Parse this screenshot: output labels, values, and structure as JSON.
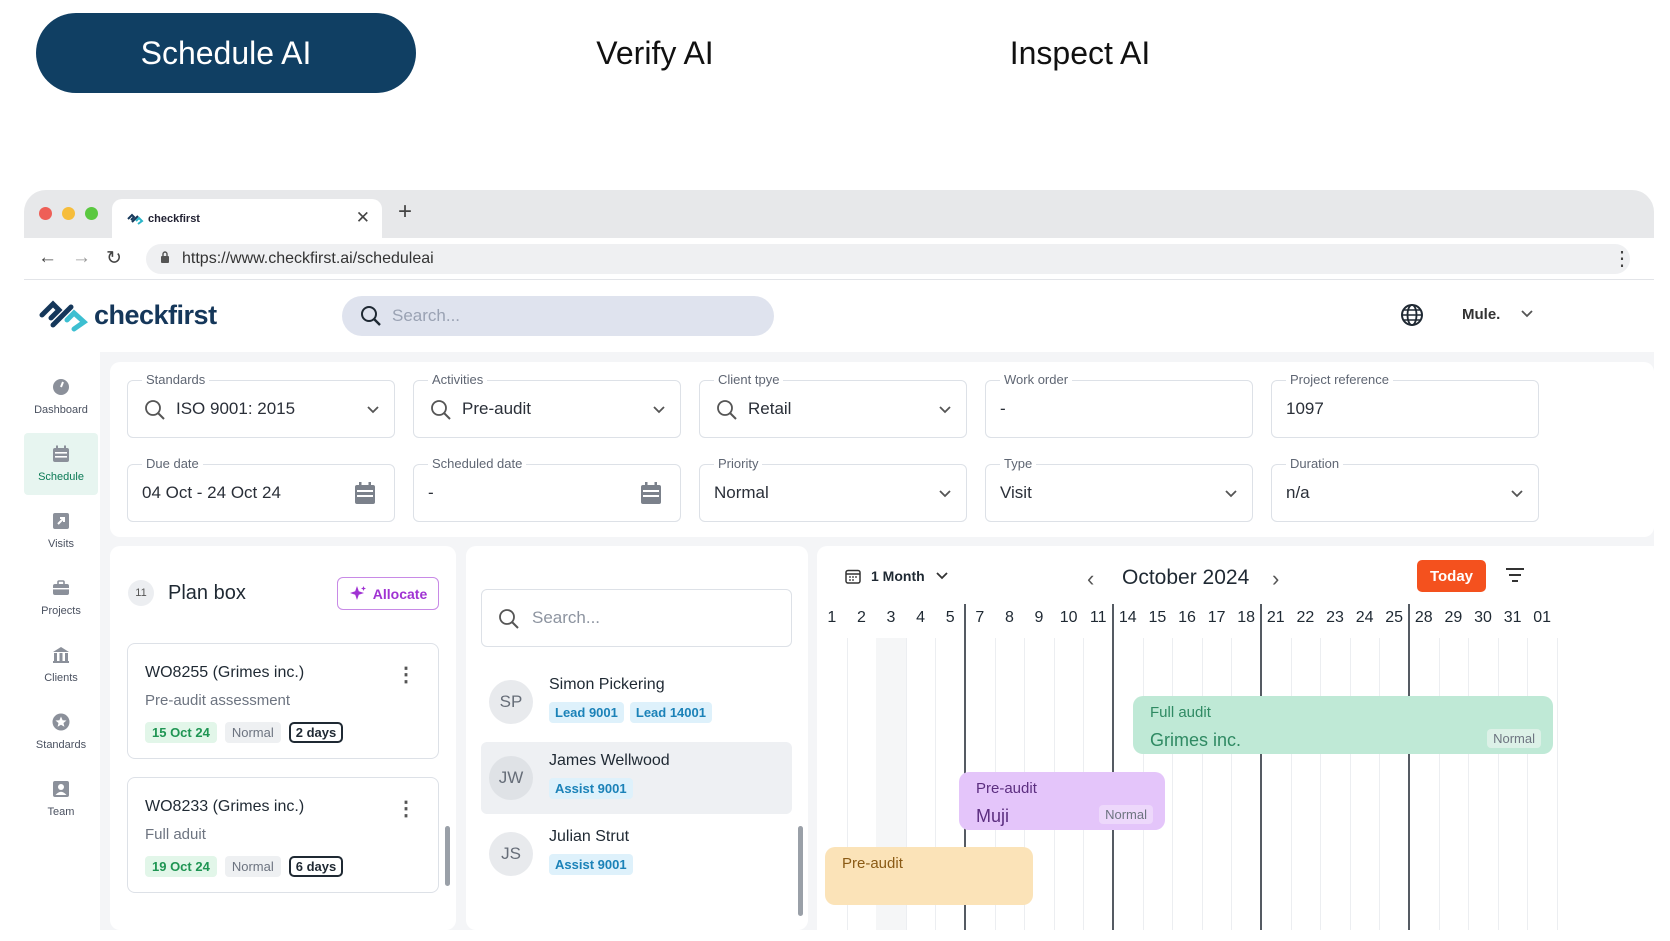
{
  "product_tabs": [
    "Schedule AI",
    "Verify AI",
    "Inspect AI"
  ],
  "browser": {
    "tab_title": "checkfirst",
    "url": "https://www.checkfirst.ai/scheduleai"
  },
  "app": {
    "logo": "checkfirst",
    "search_placeholder": "Search...",
    "user": "Mule."
  },
  "sidebar": [
    {
      "label": "Dashboard",
      "icon": "dashboard-icon"
    },
    {
      "label": "Schedule",
      "icon": "calendar-icon",
      "active": true
    },
    {
      "label": "Visits",
      "icon": "visits-icon"
    },
    {
      "label": "Projects",
      "icon": "briefcase-icon"
    },
    {
      "label": "Clients",
      "icon": "building-icon"
    },
    {
      "label": "Standards",
      "icon": "star-icon"
    },
    {
      "label": "Team",
      "icon": "person-icon"
    }
  ],
  "filters": [
    {
      "label": "Standards",
      "value": "ISO 9001: 2015"
    },
    {
      "label": "Activities",
      "value": "Pre-audit"
    },
    {
      "label": "Client tpye",
      "value": "Retail"
    },
    {
      "label": "Work order",
      "value": "-"
    },
    {
      "label": "Project reference",
      "value": "1097"
    },
    {
      "label": "Due date",
      "value": "04 Oct - 24 Oct 24"
    },
    {
      "label": "Scheduled date",
      "value": "-"
    },
    {
      "label": "Priority",
      "value": "Normal"
    },
    {
      "label": "Type",
      "value": "Visit"
    },
    {
      "label": "Duration",
      "value": "n/a"
    }
  ],
  "planbox": {
    "count": "11",
    "title": "Plan box",
    "allocate_label": "Allocate",
    "cards": [
      {
        "title": "WO8255 (Grimes inc.)",
        "subtitle": "Pre-audit assessment",
        "date": "15 Oct 24",
        "priority": "Normal",
        "duration": "2 days"
      },
      {
        "title": "WO8233 (Grimes inc.)",
        "subtitle": "Full aduit",
        "date": "19 Oct 24",
        "priority": "Normal",
        "duration": "6 days"
      }
    ]
  },
  "people": {
    "search_placeholder": "Search...",
    "list": [
      {
        "initials": "SP",
        "name": "Simon Pickering",
        "tags": [
          "Lead 9001",
          "Lead 14001"
        ]
      },
      {
        "initials": "JW",
        "name": "James Wellwood",
        "tags": [
          "Assist 9001"
        ],
        "selected": true
      },
      {
        "initials": "JS",
        "name": "Julian Strut",
        "tags": [
          "Assist 9001"
        ]
      }
    ]
  },
  "calendar": {
    "view": "1 Month",
    "month": "October 2024",
    "today_label": "Today",
    "days": [
      "1",
      "2",
      "3",
      "4",
      "5",
      "7",
      "8",
      "9",
      "10",
      "11",
      "14",
      "15",
      "16",
      "17",
      "18",
      "21",
      "22",
      "23",
      "24",
      "25",
      "28",
      "29",
      "30",
      "31",
      "01"
    ],
    "events": [
      {
        "type": "Full audit",
        "client": "Grimes inc.",
        "priority": "Normal"
      },
      {
        "type": "Pre-audit",
        "client": "Muji",
        "priority": "Normal"
      },
      {
        "type": "Pre-audit",
        "client": ""
      }
    ]
  }
}
